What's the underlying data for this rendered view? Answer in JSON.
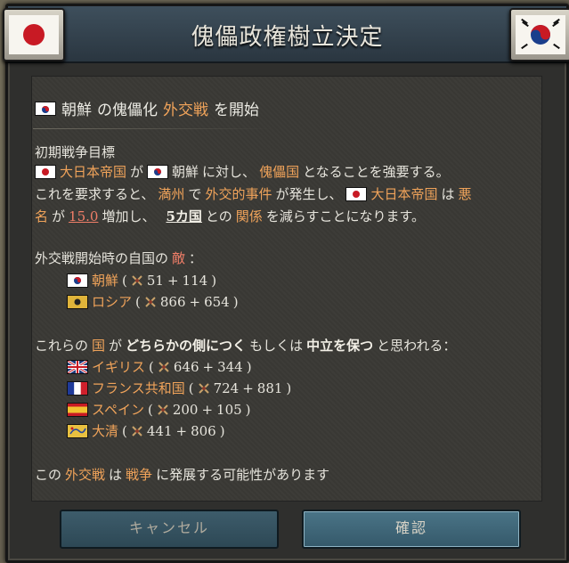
{
  "dialog": {
    "title": "傀儡政権樹立決定",
    "subtitle": {
      "country": "朝鮮",
      "mid": "の傀儡化",
      "highlight": "外交戦",
      "tail": "を開始"
    },
    "goal_heading": "初期戦争目標",
    "goal_line1": {
      "actor": "大日本帝国",
      "text1": "が",
      "target": "朝鮮",
      "text2": "に対し、",
      "puppet": "傀儡国",
      "text3": "となることを強要する。"
    },
    "goal_line2": {
      "text1": "これを要求すると、",
      "place": "満州",
      "text2": "で",
      "incident": "外交的事件",
      "text3": "が発生し、",
      "actor": "大日本帝国",
      "text4": "は",
      "infamy_word": "悪"
    },
    "goal_line3": {
      "infamy_word2": "名",
      "text1": "が",
      "infamy_value": "15.0",
      "text2": "増加し、",
      "count": "5カ国",
      "text3": "との",
      "relation": "関係",
      "text4": "を減らすことになります。"
    },
    "enemies_heading": {
      "text1": "外交戦開始時の自国の",
      "enemy": "敵",
      "text2": "："
    },
    "enemies": [
      {
        "name": "朝鮮",
        "base": "51",
        "plus": "114",
        "flag": "korea"
      },
      {
        "name": "ロシア",
        "base": "866",
        "plus": "654",
        "flag": "russia"
      }
    ],
    "neutral_heading": {
      "text1": "これらの",
      "country": "国",
      "text2": "が",
      "side": "どちらかの側につく",
      "text3": "もしくは",
      "neutral": "中立を保つ",
      "text4": "と思われる："
    },
    "neutrals": [
      {
        "name": "イギリス",
        "base": "646",
        "plus": "344",
        "flag": "uk"
      },
      {
        "name": "フランス共和国",
        "base": "724",
        "plus": "881",
        "flag": "france"
      },
      {
        "name": "スペイン",
        "base": "200",
        "plus": "105",
        "flag": "spain"
      },
      {
        "name": "大清",
        "base": "441",
        "plus": "806",
        "flag": "qing"
      }
    ],
    "warning": {
      "text1": "この",
      "crisis": "外交戦",
      "text2": "は",
      "war": "戦争",
      "text3": "に発展する可能性があります"
    },
    "cancel_label": "キャンセル",
    "confirm_label": "確認"
  },
  "icons": {
    "flag_left": "japan-flag-icon",
    "flag_right": "korea-flag-icon",
    "sword": "crossed-swords-icon"
  },
  "colors": {
    "orange": "#f0a35a",
    "red": "#f07e68",
    "gold": "#f2d67a",
    "header": "#3e4f5c",
    "confirm": "#4a7487"
  }
}
